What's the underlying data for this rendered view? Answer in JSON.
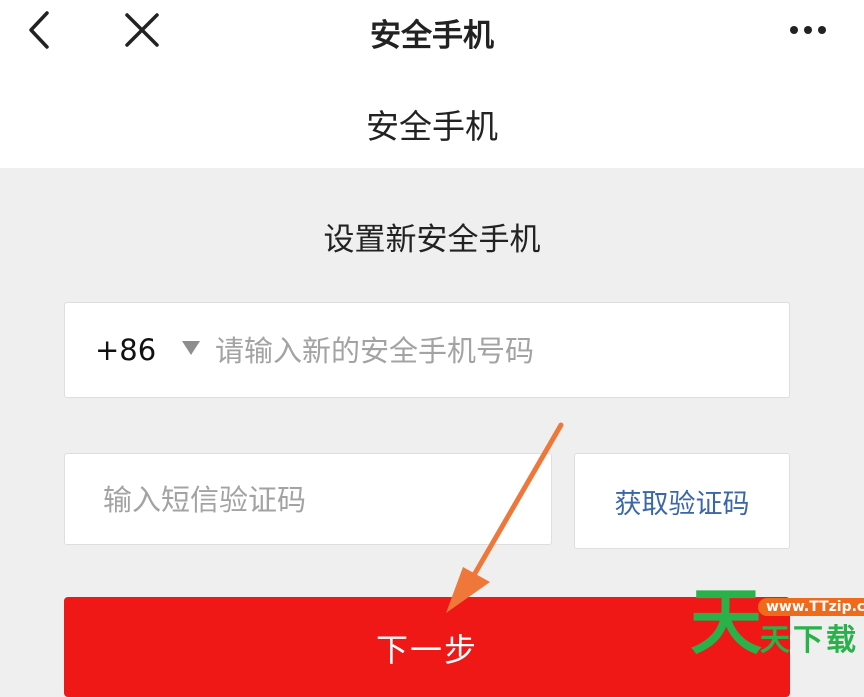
{
  "nav": {
    "title": "安全手机",
    "back_icon": "chevron-left-icon",
    "close_icon": "close-icon",
    "more_icon": "more-dots-icon"
  },
  "header": {
    "title": "安全手机"
  },
  "form": {
    "section_title": "设置新安全手机",
    "country_code": "+86",
    "phone_placeholder": "请输入新的安全手机号码",
    "phone_value": "",
    "code_placeholder": "输入短信验证码",
    "code_value": "",
    "get_code_label": "获取验证码",
    "next_label": "下一步"
  },
  "annotation": {
    "arrow_color": "#f0773a"
  },
  "watermark": {
    "big_char": "天",
    "url": "www.TTzip.com",
    "text": "天下载"
  },
  "colors": {
    "primary_red": "#f01717",
    "link_blue": "#3b66a8",
    "background": "#efefef"
  }
}
